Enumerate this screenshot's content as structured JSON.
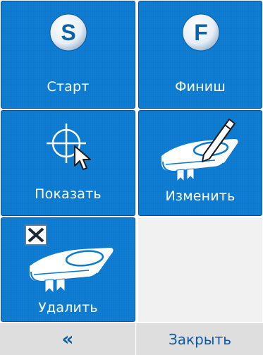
{
  "tiles": {
    "start": {
      "label": "Старт",
      "letter": "S"
    },
    "finish": {
      "label": "Финиш",
      "letter": "F"
    },
    "show": {
      "label": "Показать"
    },
    "edit": {
      "label": "Изменить"
    },
    "delete": {
      "label": "Удалить"
    }
  },
  "bottom_bar": {
    "back_label": "«",
    "close_label": "Закрыть"
  },
  "icons": {
    "start": "letter-s-circle-icon",
    "finish": "letter-f-circle-icon",
    "show": "crosshair-cursor-icon",
    "edit": "book-pencil-icon",
    "delete": "book-delete-icon"
  },
  "colors": {
    "tile_blue": "#0a79cf",
    "bar_text": "#0b5ba6",
    "bar_bg": "#dedede"
  }
}
